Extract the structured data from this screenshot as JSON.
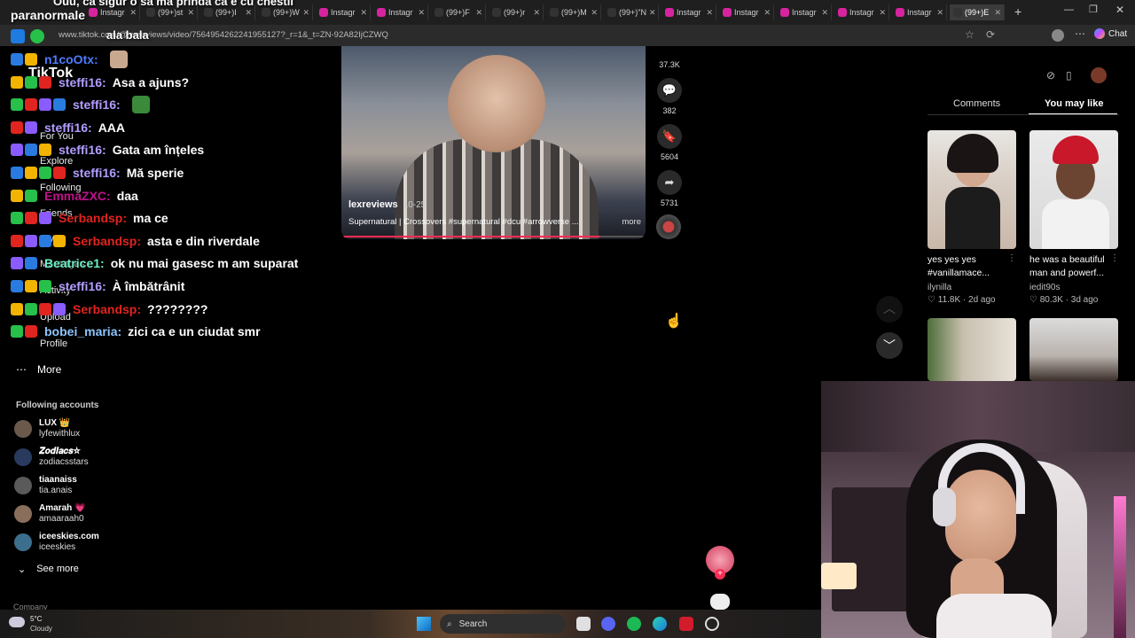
{
  "overlay": {
    "top_line": "Ouu, ca sigur o sa ma prinda ca e cu chestii",
    "streamer": "paranormale",
    "user_label": "ala bala"
  },
  "tabs": [
    {
      "label": "Instagr",
      "icon": "instagram-icon",
      "color": "#d6249f"
    },
    {
      "label": "(99+)st",
      "icon": "tiktok-icon",
      "color": "#333"
    },
    {
      "label": "(99+)I",
      "icon": "tiktok-icon",
      "color": "#333"
    },
    {
      "label": "(99+)W",
      "icon": "tiktok-icon",
      "color": "#333"
    },
    {
      "label": "Instagr",
      "icon": "instagram-icon",
      "color": "#d6249f"
    },
    {
      "label": "Instagr",
      "icon": "instagram-icon",
      "color": "#d6249f"
    },
    {
      "label": "(99+)F",
      "icon": "tiktok-icon",
      "color": "#333"
    },
    {
      "label": "(99+)r",
      "icon": "tiktok-icon",
      "color": "#333"
    },
    {
      "label": "(99+)M",
      "icon": "tiktok-icon",
      "color": "#333"
    },
    {
      "label": "(99+)\"N",
      "icon": "tiktok-icon",
      "color": "#333"
    },
    {
      "label": "Instagr",
      "icon": "instagram-icon",
      "color": "#d6249f"
    },
    {
      "label": "Instagr",
      "icon": "instagram-icon",
      "color": "#d6249f"
    },
    {
      "label": "Instagr",
      "icon": "instagram-icon",
      "color": "#d6249f"
    },
    {
      "label": "Instagr",
      "icon": "instagram-icon",
      "color": "#d6249f"
    },
    {
      "label": "Instagr",
      "icon": "instagram-icon",
      "color": "#d6249f"
    },
    {
      "label": "(99+)E",
      "icon": "tiktok-icon",
      "color": "#333"
    }
  ],
  "address": {
    "url": "www.tiktok.com/@lexreviews/video/7564954262241955127?_r=1&_t=ZN-92A82IjCZWQ",
    "chat_label": "Chat"
  },
  "tiktok": {
    "logo": "TikTok",
    "nav": [
      "For You",
      "Explore",
      "Following",
      "Friends",
      "LIVE",
      "Messages",
      "Activity",
      "Upload",
      "Profile"
    ],
    "more": "More",
    "following_title": "Following accounts",
    "see_more": "See more",
    "company": "Company",
    "accounts": [
      {
        "name": "LUX 👑",
        "handle": "lyfewithlux",
        "color": "#6b5a4c"
      },
      {
        "name": "𝒁𝒐𝒅𝒊𝒂𝒄𝒔☆",
        "handle": "zodiacsstars",
        "color": "#2a3a5e"
      },
      {
        "name": "tiaanaiss",
        "handle": "tia.anais",
        "color": "#5a5a5a"
      },
      {
        "name": "Amarah 💗",
        "handle": "amaaraah0",
        "color": "#8a6e5c"
      },
      {
        "name": "iceeskies.com",
        "handle": "iceeskies",
        "color": "#3c6e8e"
      }
    ]
  },
  "chat": [
    {
      "user": "n1coOtx:",
      "color": "#4f7cff",
      "msg": ""
    },
    {
      "user": "steffi16:",
      "color": "#b29dff",
      "msg": "Asa a ajuns?"
    },
    {
      "user": "steffi16:",
      "color": "#b29dff",
      "msg": ""
    },
    {
      "user": "steffi16:",
      "color": "#b29dff",
      "msg": "AAA"
    },
    {
      "user": "steffi16:",
      "color": "#b29dff",
      "msg": "Gata am înțeles"
    },
    {
      "user": "steffi16:",
      "color": "#b29dff",
      "msg": "Mă sperie"
    },
    {
      "user": "EmmaZXC:",
      "color": "#c0128a",
      "msg": "daa"
    },
    {
      "user": "Serbandsp:",
      "color": "#e0241f",
      "msg": "ma ce"
    },
    {
      "user": "Serbandsp:",
      "color": "#e0241f",
      "msg": "asta e din riverdale"
    },
    {
      "user": "Beatrice1:",
      "color": "#6df0c8",
      "msg": "ok nu mai gasesc m am suparat"
    },
    {
      "user": "steffi16:",
      "color": "#b29dff",
      "msg": "À îmbătrânit"
    },
    {
      "user": "Serbandsp:",
      "color": "#e0241f",
      "msg": "????????"
    },
    {
      "user": "bobei_maria:",
      "color": "#8ec5ff",
      "msg": "zici ca e un ciudat smr"
    }
  ],
  "video": {
    "author": "lexreviews",
    "date": "10-25",
    "caption": "Supernatural | Crossovers #supernatural #dcu #arrowverse ...",
    "more": "more",
    "counts": {
      "likes": "37.3K",
      "comments": "382",
      "saves": "5604",
      "shares": "5731"
    }
  },
  "sidebar": {
    "tab_comments": "Comments",
    "tab_you_may_like": "You may like",
    "videos": [
      {
        "title": "yes yes yes #vanillamace...",
        "author": "ilynilla",
        "likes": "11.8K",
        "age": "2d ago"
      },
      {
        "title": "he was a beautiful man and powerf...",
        "author": "iedit90s",
        "likes": "80.3K",
        "age": "3d ago"
      }
    ]
  },
  "taskbar": {
    "temp": "5°C",
    "weather": "Cloudy",
    "search": "Search"
  }
}
